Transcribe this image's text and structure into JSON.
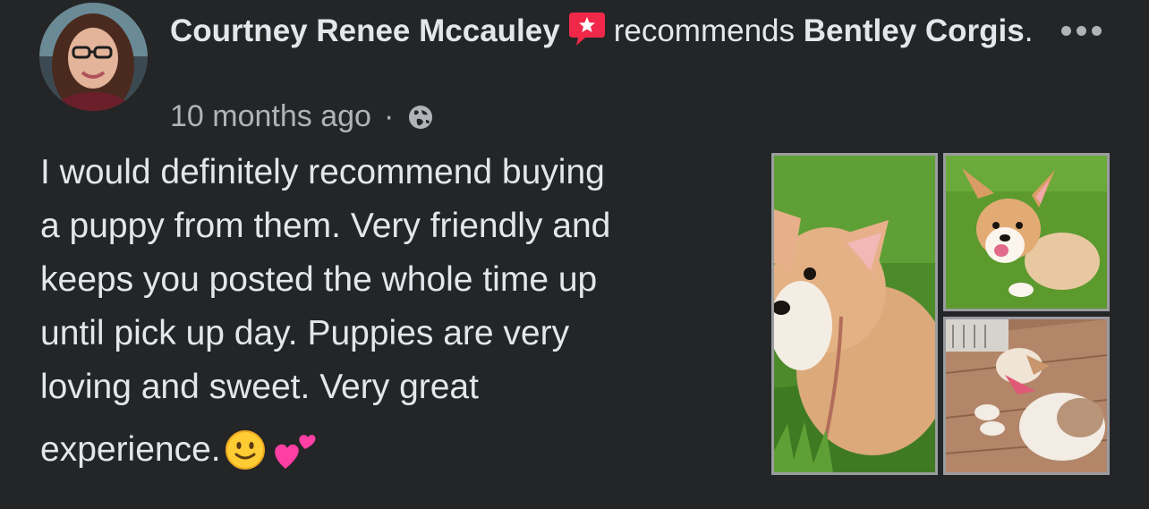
{
  "post": {
    "author": "Courtney Renee Mccauley",
    "verb": "recommends",
    "page_name": "Bentley Corgis",
    "page_suffix": ".",
    "timestamp": "10 months ago",
    "separator": "·",
    "privacy_icon": "globe-icon",
    "recommend_icon": "recommend-star-icon",
    "more_icon": "more-options-icon",
    "body": "I would definitely recommend buying\na puppy from them. Very friendly and\nkeeps you posted the whole time up\nuntil pick up day. Puppies are very\nloving and sweet. Very great",
    "body_last": "experience.",
    "emojis": [
      "slightly-smiling-face-emoji",
      "two-hearts-emoji"
    ],
    "photos": [
      "corgi-puppy-closeup-photo",
      "corgi-puppy-on-grass-photo",
      "corgi-puppy-sleeping-photo"
    ]
  },
  "colors": {
    "background": "#242526",
    "primary_text": "#e4e6eb",
    "secondary_text": "#b0b3b8",
    "recommend_red": "#f02849",
    "photo_border": "#9a9c9f"
  }
}
